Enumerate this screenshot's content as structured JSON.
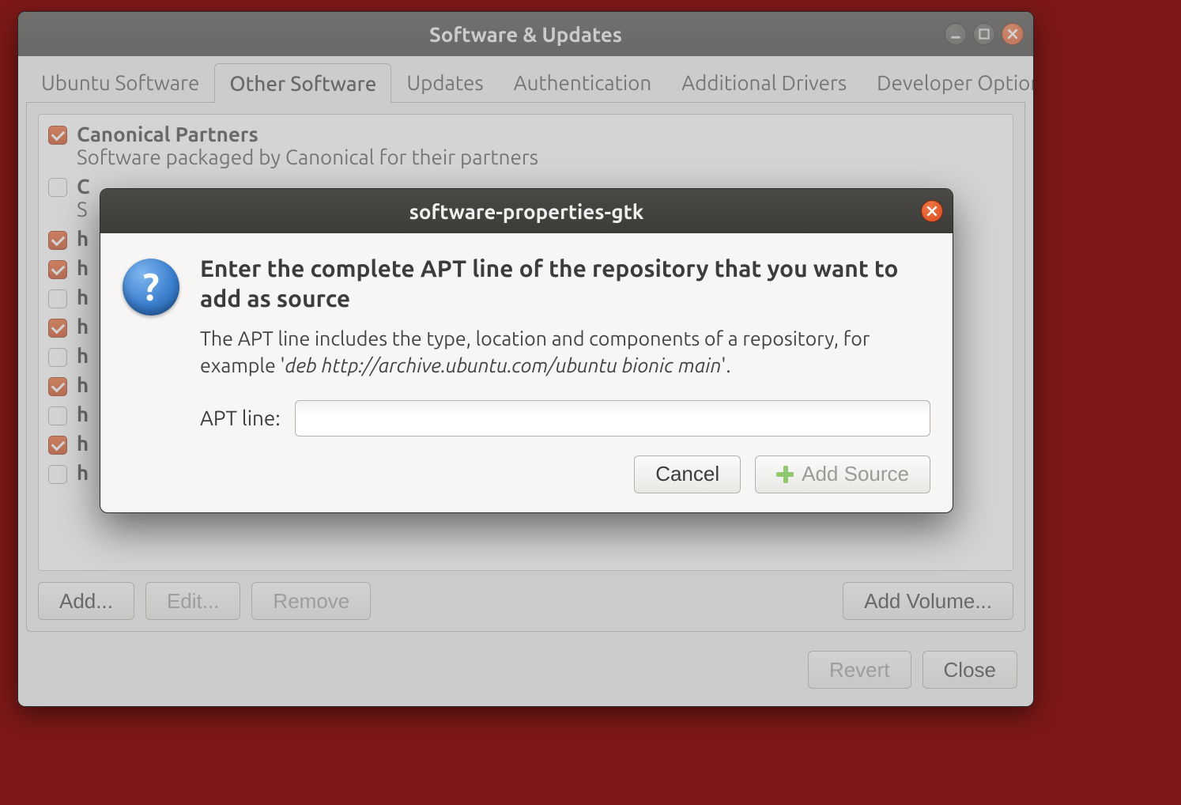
{
  "main_window": {
    "title": "Software & Updates",
    "tabs": [
      {
        "label": "Ubuntu Software",
        "active": false
      },
      {
        "label": "Other Software",
        "active": true
      },
      {
        "label": "Updates",
        "active": false
      },
      {
        "label": "Authentication",
        "active": false
      },
      {
        "label": "Additional Drivers",
        "active": false
      },
      {
        "label": "Developer Options",
        "active": false
      }
    ],
    "sources": [
      {
        "checked": true,
        "title": "Canonical Partners",
        "subtitle": "Software packaged by Canonical for their partners"
      },
      {
        "checked": false,
        "title": "C",
        "subtitle": "S"
      },
      {
        "checked": true,
        "line": "h"
      },
      {
        "checked": true,
        "line": "h"
      },
      {
        "checked": false,
        "line": "h"
      },
      {
        "checked": true,
        "line": "h"
      },
      {
        "checked": false,
        "line": "h"
      },
      {
        "checked": true,
        "line": "h"
      },
      {
        "checked": false,
        "line": "h"
      },
      {
        "checked": true,
        "line": "h"
      },
      {
        "checked": false,
        "line": "h"
      }
    ],
    "buttons": {
      "add": "Add...",
      "edit": "Edit...",
      "remove": "Remove",
      "add_volume": "Add Volume...",
      "revert": "Revert",
      "close": "Close"
    }
  },
  "dialog": {
    "title": "software-properties-gtk",
    "heading": "Enter the complete APT line of the repository that you want to add as source",
    "description_pre": "The APT line includes the type, location and components of a repository, for example  '",
    "description_example": "deb http://archive.ubuntu.com/ubuntu bionic main",
    "description_post": "'.",
    "apt_label": "APT line:",
    "apt_value": "",
    "cancel": "Cancel",
    "add_source": "Add Source",
    "glyph": "?"
  }
}
